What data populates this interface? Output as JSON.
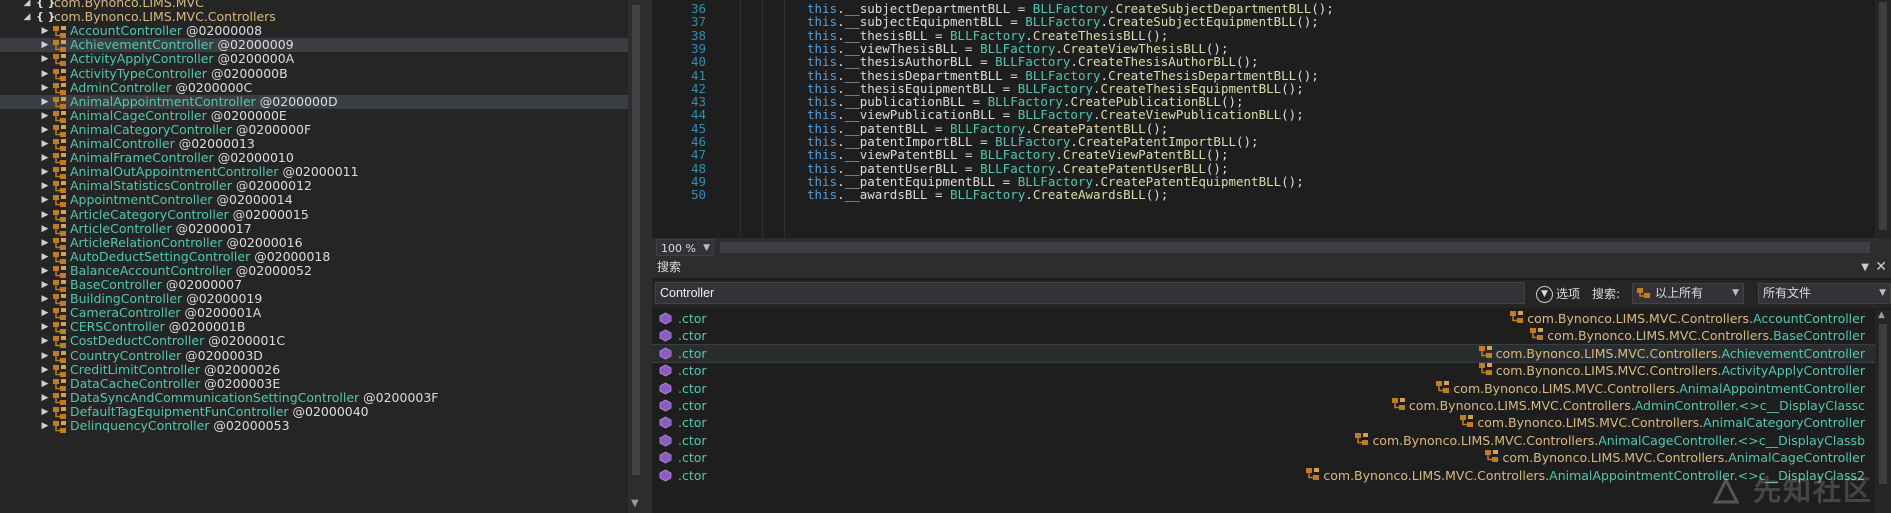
{
  "tree": {
    "items": [
      {
        "kind": "ns",
        "label": "com.Bynonco.LIMS.MVC",
        "expanded": true
      },
      {
        "kind": "ns",
        "label": "com.Bynonco.LIMS.MVC.Controllers",
        "expanded": true
      },
      {
        "kind": "cls",
        "label": "AccountController",
        "token": "@02000008"
      },
      {
        "kind": "cls",
        "label": "AchievementController",
        "token": "@02000009",
        "highlighted": true
      },
      {
        "kind": "cls",
        "label": "ActivityApplyController",
        "token": "@0200000A"
      },
      {
        "kind": "cls",
        "label": "ActivityTypeController",
        "token": "@0200000B"
      },
      {
        "kind": "cls",
        "label": "AdminController",
        "token": "@0200000C"
      },
      {
        "kind": "cls",
        "label": "AnimalAppointmentController",
        "token": "@0200000D",
        "highlighted": true
      },
      {
        "kind": "cls",
        "label": "AnimalCageController",
        "token": "@0200000E"
      },
      {
        "kind": "cls",
        "label": "AnimalCategoryController",
        "token": "@0200000F"
      },
      {
        "kind": "cls",
        "label": "AnimalController",
        "token": "@02000013"
      },
      {
        "kind": "cls",
        "label": "AnimalFrameController",
        "token": "@02000010"
      },
      {
        "kind": "cls",
        "label": "AnimalOutAppointmentController",
        "token": "@02000011"
      },
      {
        "kind": "cls",
        "label": "AnimalStatisticsController",
        "token": "@02000012"
      },
      {
        "kind": "cls",
        "label": "AppointmentController",
        "token": "@02000014"
      },
      {
        "kind": "cls",
        "label": "ArticleCategoryController",
        "token": "@02000015"
      },
      {
        "kind": "cls",
        "label": "ArticleController",
        "token": "@02000017"
      },
      {
        "kind": "cls",
        "label": "ArticleRelationController",
        "token": "@02000016"
      },
      {
        "kind": "cls",
        "label": "AutoDeductSettingController",
        "token": "@02000018"
      },
      {
        "kind": "cls",
        "label": "BalanceAccountController",
        "token": "@02000052"
      },
      {
        "kind": "cls",
        "label": "BaseController",
        "token": "@02000007"
      },
      {
        "kind": "cls",
        "label": "BuildingController",
        "token": "@02000019"
      },
      {
        "kind": "cls",
        "label": "CameraController",
        "token": "@0200001A"
      },
      {
        "kind": "cls",
        "label": "CERSController",
        "token": "@0200001B"
      },
      {
        "kind": "cls",
        "label": "CostDeductController",
        "token": "@0200001C"
      },
      {
        "kind": "cls",
        "label": "CountryController",
        "token": "@0200003D"
      },
      {
        "kind": "cls",
        "label": "CreditLimitController",
        "token": "@02000026"
      },
      {
        "kind": "cls",
        "label": "DataCacheController",
        "token": "@0200003E"
      },
      {
        "kind": "cls",
        "label": "DataSyncAndCommunicationSettingController",
        "token": "@0200003F"
      },
      {
        "kind": "cls",
        "label": "DefaultTagEquipmentFunController",
        "token": "@02000040"
      },
      {
        "kind": "cls",
        "label": "DelinquencyController",
        "token": "@02000053"
      }
    ]
  },
  "code": {
    "lines": [
      {
        "n": "36",
        "field": "__subjectDepartmentBLL",
        "method": "CreateSubjectDepartmentBLL"
      },
      {
        "n": "37",
        "field": "__subjectEquipmentBLL",
        "method": "CreateSubjectEquipmentBLL"
      },
      {
        "n": "38",
        "field": "__thesisBLL",
        "method": "CreateThesisBLL"
      },
      {
        "n": "39",
        "field": "__viewThesisBLL",
        "method": "CreateViewThesisBLL"
      },
      {
        "n": "40",
        "field": "__thesisAuthorBLL",
        "method": "CreateThesisAuthorBLL"
      },
      {
        "n": "41",
        "field": "__thesisDepartmentBLL",
        "method": "CreateThesisDepartmentBLL"
      },
      {
        "n": "42",
        "field": "__thesisEquipmentBLL",
        "method": "CreateThesisEquipmentBLL"
      },
      {
        "n": "43",
        "field": "__publicationBLL",
        "method": "CreatePublicationBLL"
      },
      {
        "n": "44",
        "field": "__viewPublicationBLL",
        "method": "CreateViewPublicationBLL"
      },
      {
        "n": "45",
        "field": "__patentBLL",
        "method": "CreatePatentBLL"
      },
      {
        "n": "46",
        "field": "__patentImportBLL",
        "method": "CreatePatentImportBLL"
      },
      {
        "n": "47",
        "field": "__viewPatentBLL",
        "method": "CreateViewPatentBLL"
      },
      {
        "n": "48",
        "field": "__patentUserBLL",
        "method": "CreatePatentUserBLL"
      },
      {
        "n": "49",
        "field": "__patentEquipmentBLL",
        "method": "CreatePatentEquipmentBLL"
      },
      {
        "n": "50",
        "field": "__awardsBLL",
        "method": "CreateAwardsBLL"
      }
    ],
    "kw_this": "this",
    "factory": "BLLFactory",
    "zoom": "100 %"
  },
  "search": {
    "title": "搜索",
    "query": "Controller",
    "options_label": "选项",
    "search_label": "搜索:",
    "scope": "以上所有",
    "files": "所有文件",
    "results": [
      {
        "name": ".ctor",
        "ns": "com.Bynonco.LIMS.MVC.Controllers.",
        "type": "AccountController"
      },
      {
        "name": ".ctor",
        "ns": "com.Bynonco.LIMS.MVC.Controllers.",
        "type": "BaseController"
      },
      {
        "name": ".ctor",
        "ns": "com.Bynonco.LIMS.MVC.Controllers.",
        "type": "AchievementController",
        "highlighted": true
      },
      {
        "name": ".ctor",
        "ns": "com.Bynonco.LIMS.MVC.Controllers.",
        "type": "ActivityApplyController"
      },
      {
        "name": ".ctor",
        "ns": "com.Bynonco.LIMS.MVC.Controllers.",
        "type": "AnimalAppointmentController"
      },
      {
        "name": ".ctor",
        "ns": "com.Bynonco.LIMS.MVC.Controllers.",
        "type": "AdminController.<>c__DisplayClassc"
      },
      {
        "name": ".ctor",
        "ns": "com.Bynonco.LIMS.MVC.Controllers.",
        "type": "AnimalCategoryController"
      },
      {
        "name": ".ctor",
        "ns": "com.Bynonco.LIMS.MVC.Controllers.",
        "type": "AnimalCageController.<>c__DisplayClassb"
      },
      {
        "name": ".ctor",
        "ns": "com.Bynonco.LIMS.MVC.Controllers.",
        "type": "AnimalCageController"
      },
      {
        "name": ".ctor",
        "ns": "com.Bynonco.LIMS.MVC.Controllers.",
        "type": "AnimalAppointmentController.<>c__DisplayClass2"
      }
    ]
  },
  "watermark": "先知社区"
}
